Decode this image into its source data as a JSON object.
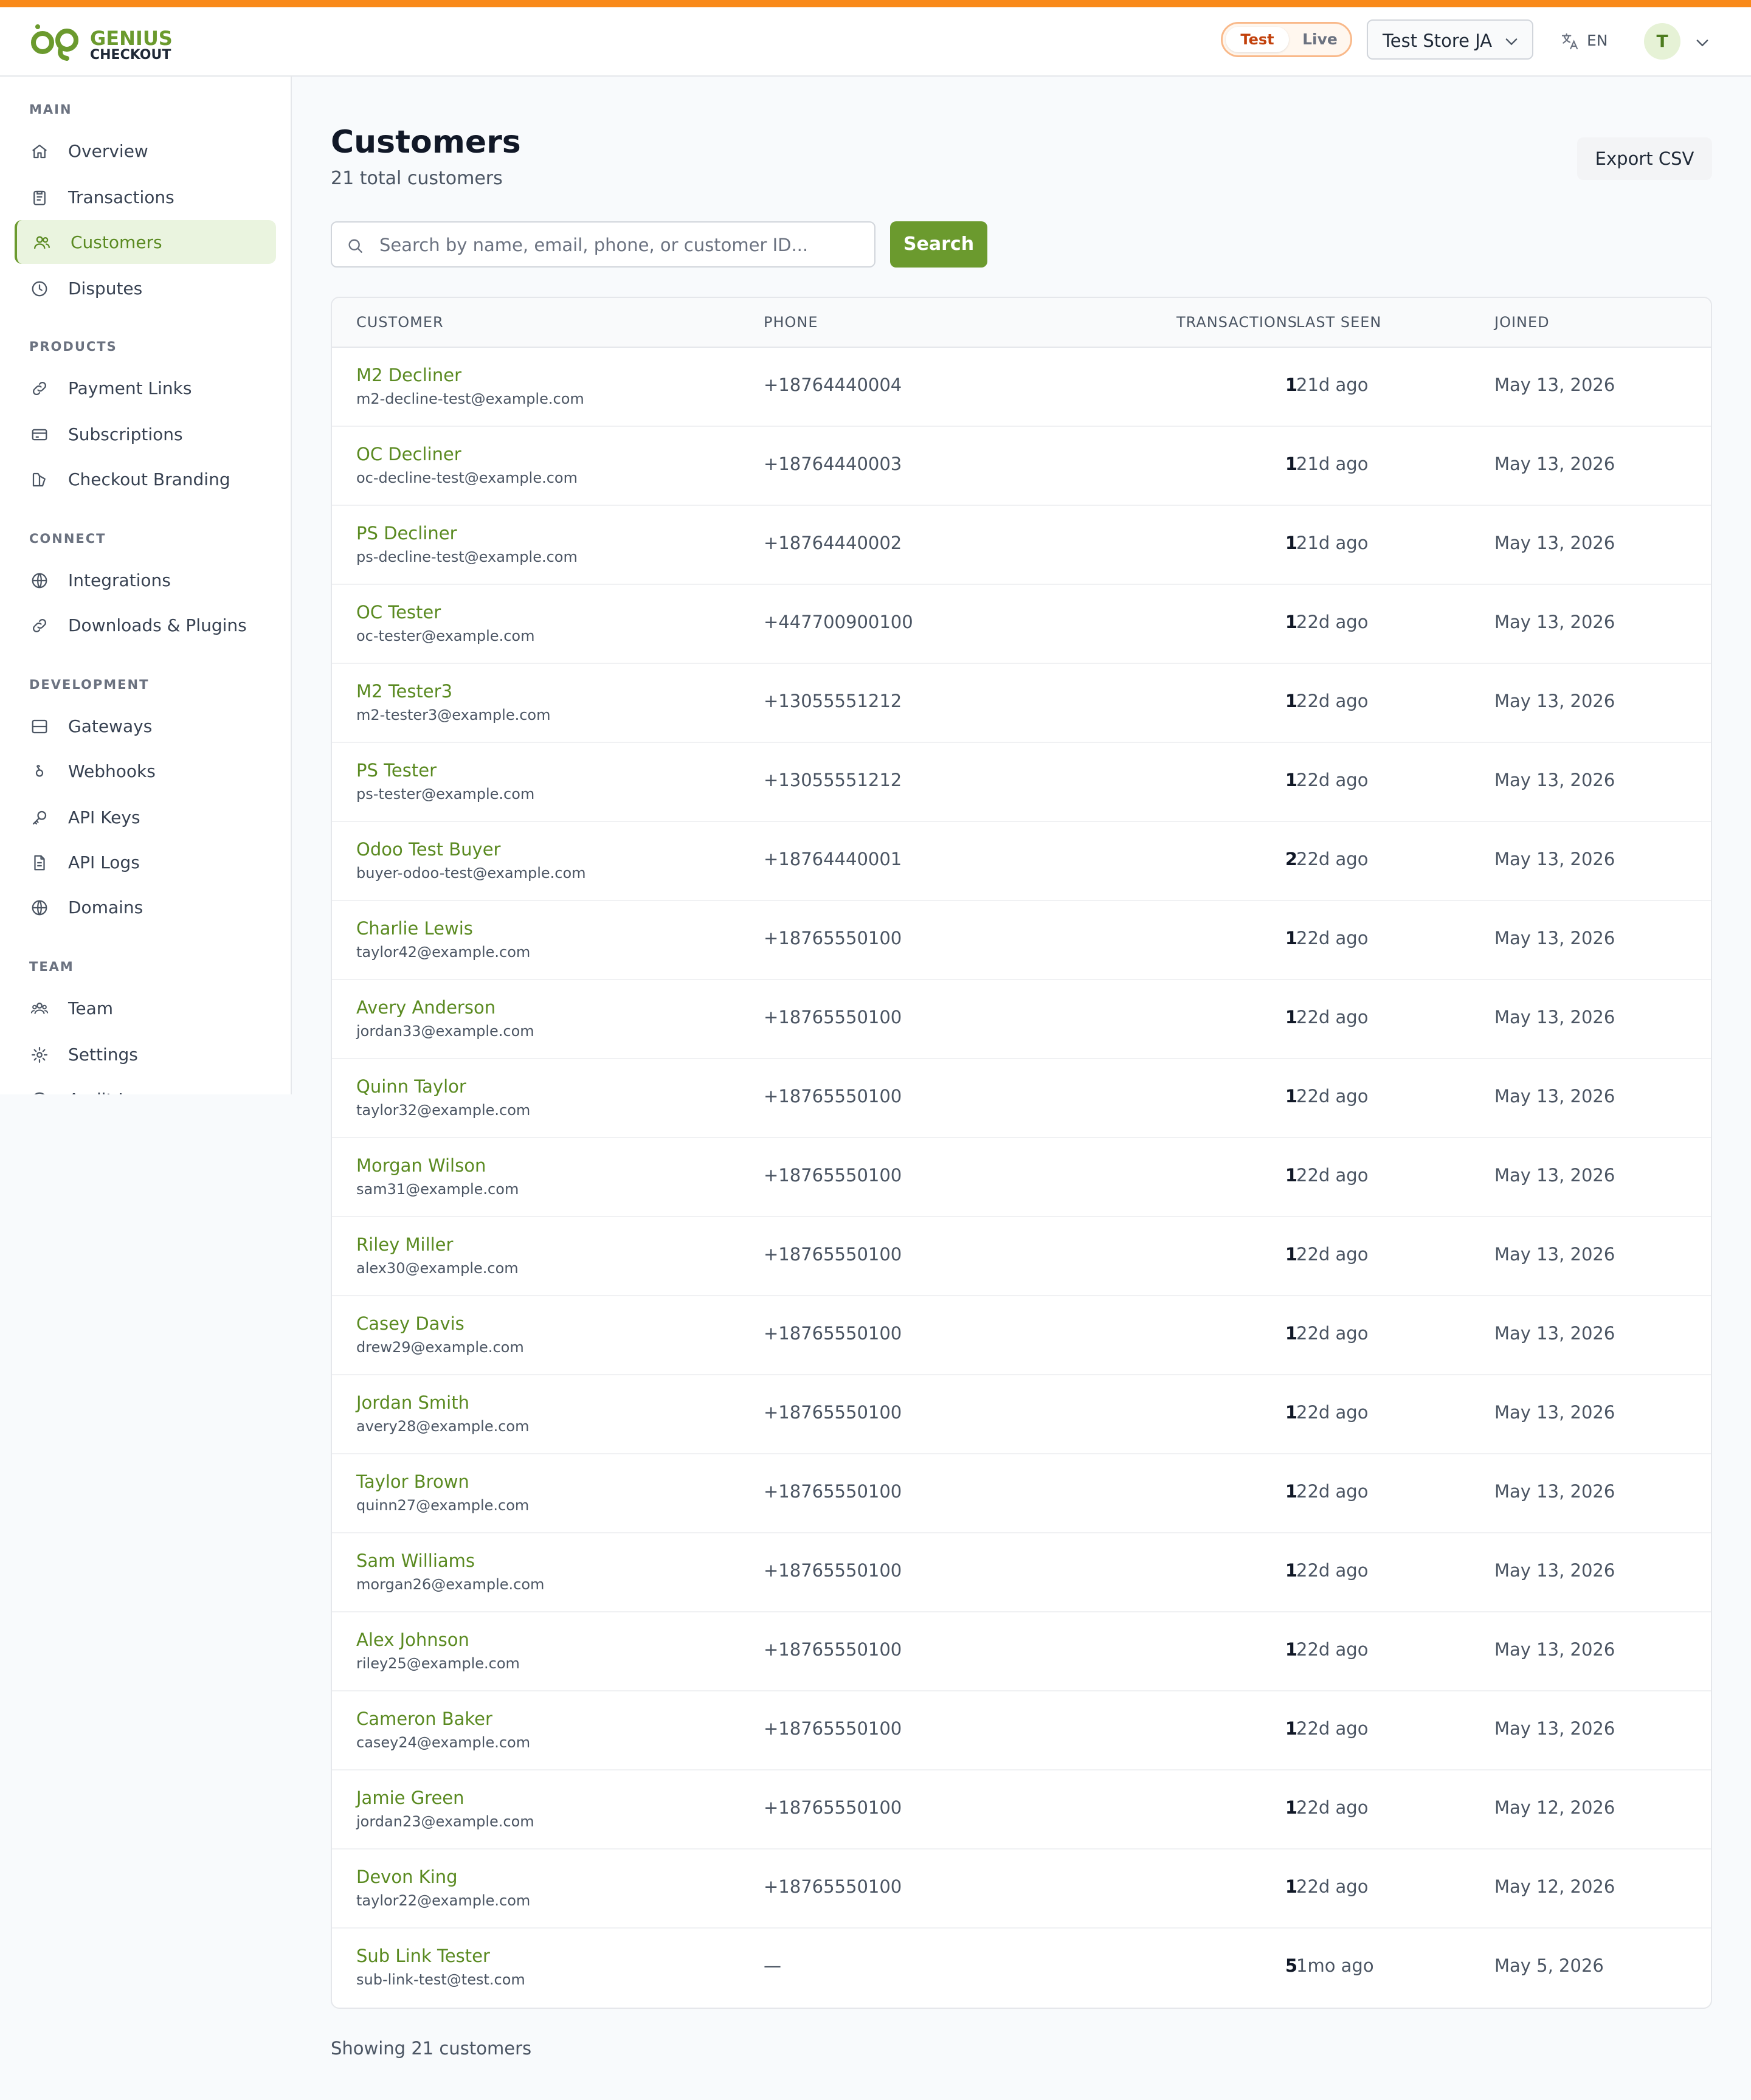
{
  "colors": {
    "accent": "#6b9a2e",
    "top_stripe": "#f98a1a",
    "test_mode": "#c2410c"
  },
  "header": {
    "logo_line1": "GENIUS",
    "logo_line2": "CHECKOUT",
    "mode_test": "Test",
    "mode_live": "Live",
    "store": "Test Store JA",
    "language": "EN",
    "avatar_initial": "T"
  },
  "sidebar": {
    "sections": [
      {
        "title": "MAIN",
        "items": [
          {
            "label": "Overview",
            "icon": "home-icon"
          },
          {
            "label": "Transactions",
            "icon": "clipboard-icon"
          },
          {
            "label": "Customers",
            "icon": "users-icon",
            "active": true
          },
          {
            "label": "Disputes",
            "icon": "clock-icon"
          }
        ]
      },
      {
        "title": "PRODUCTS",
        "items": [
          {
            "label": "Payment Links",
            "icon": "link-icon"
          },
          {
            "label": "Subscriptions",
            "icon": "card-icon"
          },
          {
            "label": "Checkout Branding",
            "icon": "paint-icon"
          }
        ]
      },
      {
        "title": "CONNECT",
        "items": [
          {
            "label": "Integrations",
            "icon": "globe-icon"
          },
          {
            "label": "Downloads & Plugins",
            "icon": "link-icon"
          }
        ]
      },
      {
        "title": "DEVELOPMENT",
        "items": [
          {
            "label": "Gateways",
            "icon": "server-icon"
          },
          {
            "label": "Webhooks",
            "icon": "webhook-icon"
          },
          {
            "label": "API Keys",
            "icon": "key-icon"
          },
          {
            "label": "API Logs",
            "icon": "file-icon"
          },
          {
            "label": "Domains",
            "icon": "globe-icon"
          }
        ]
      },
      {
        "title": "TEAM",
        "items": [
          {
            "label": "Team",
            "icon": "team-icon"
          },
          {
            "label": "Settings",
            "icon": "gear-icon"
          },
          {
            "label": "Audit Log",
            "icon": "clock-icon"
          }
        ]
      }
    ]
  },
  "page": {
    "title": "Customers",
    "subtitle": "21 total customers",
    "export_label": "Export CSV",
    "search_placeholder": "Search by name, email, phone, or customer ID...",
    "search_label": "Search",
    "footer": "Showing 21 customers"
  },
  "table": {
    "headers": [
      "CUSTOMER",
      "PHONE",
      "TRANSACTIONS",
      "LAST SEEN",
      "JOINED"
    ],
    "rows": [
      {
        "name": "M2 Decliner",
        "email": "m2-decline-test@example.com",
        "phone": "+18764440004",
        "transactions": "1",
        "last_seen": "21d ago",
        "joined": "May 13, 2026"
      },
      {
        "name": "OC Decliner",
        "email": "oc-decline-test@example.com",
        "phone": "+18764440003",
        "transactions": "1",
        "last_seen": "21d ago",
        "joined": "May 13, 2026"
      },
      {
        "name": "PS Decliner",
        "email": "ps-decline-test@example.com",
        "phone": "+18764440002",
        "transactions": "1",
        "last_seen": "21d ago",
        "joined": "May 13, 2026"
      },
      {
        "name": "OC Tester",
        "email": "oc-tester@example.com",
        "phone": "+447700900100",
        "transactions": "1",
        "last_seen": "22d ago",
        "joined": "May 13, 2026"
      },
      {
        "name": "M2 Tester3",
        "email": "m2-tester3@example.com",
        "phone": "+13055551212",
        "transactions": "1",
        "last_seen": "22d ago",
        "joined": "May 13, 2026"
      },
      {
        "name": "PS Tester",
        "email": "ps-tester@example.com",
        "phone": "+13055551212",
        "transactions": "1",
        "last_seen": "22d ago",
        "joined": "May 13, 2026"
      },
      {
        "name": "Odoo Test Buyer",
        "email": "buyer-odoo-test@example.com",
        "phone": "+18764440001",
        "transactions": "2",
        "last_seen": "22d ago",
        "joined": "May 13, 2026"
      },
      {
        "name": "Charlie Lewis",
        "email": "taylor42@example.com",
        "phone": "+18765550100",
        "transactions": "1",
        "last_seen": "22d ago",
        "joined": "May 13, 2026"
      },
      {
        "name": "Avery Anderson",
        "email": "jordan33@example.com",
        "phone": "+18765550100",
        "transactions": "1",
        "last_seen": "22d ago",
        "joined": "May 13, 2026"
      },
      {
        "name": "Quinn Taylor",
        "email": "taylor32@example.com",
        "phone": "+18765550100",
        "transactions": "1",
        "last_seen": "22d ago",
        "joined": "May 13, 2026"
      },
      {
        "name": "Morgan Wilson",
        "email": "sam31@example.com",
        "phone": "+18765550100",
        "transactions": "1",
        "last_seen": "22d ago",
        "joined": "May 13, 2026"
      },
      {
        "name": "Riley Miller",
        "email": "alex30@example.com",
        "phone": "+18765550100",
        "transactions": "1",
        "last_seen": "22d ago",
        "joined": "May 13, 2026"
      },
      {
        "name": "Casey Davis",
        "email": "drew29@example.com",
        "phone": "+18765550100",
        "transactions": "1",
        "last_seen": "22d ago",
        "joined": "May 13, 2026"
      },
      {
        "name": "Jordan Smith",
        "email": "avery28@example.com",
        "phone": "+18765550100",
        "transactions": "1",
        "last_seen": "22d ago",
        "joined": "May 13, 2026"
      },
      {
        "name": "Taylor Brown",
        "email": "quinn27@example.com",
        "phone": "+18765550100",
        "transactions": "1",
        "last_seen": "22d ago",
        "joined": "May 13, 2026"
      },
      {
        "name": "Sam Williams",
        "email": "morgan26@example.com",
        "phone": "+18765550100",
        "transactions": "1",
        "last_seen": "22d ago",
        "joined": "May 13, 2026"
      },
      {
        "name": "Alex Johnson",
        "email": "riley25@example.com",
        "phone": "+18765550100",
        "transactions": "1",
        "last_seen": "22d ago",
        "joined": "May 13, 2026"
      },
      {
        "name": "Cameron Baker",
        "email": "casey24@example.com",
        "phone": "+18765550100",
        "transactions": "1",
        "last_seen": "22d ago",
        "joined": "May 13, 2026"
      },
      {
        "name": "Jamie Green",
        "email": "jordan23@example.com",
        "phone": "+18765550100",
        "transactions": "1",
        "last_seen": "22d ago",
        "joined": "May 12, 2026"
      },
      {
        "name": "Devon King",
        "email": "taylor22@example.com",
        "phone": "+18765550100",
        "transactions": "1",
        "last_seen": "22d ago",
        "joined": "May 12, 2026"
      },
      {
        "name": "Sub Link Tester",
        "email": "sub-link-test@test.com",
        "phone": "—",
        "transactions": "5",
        "last_seen": "1mo ago",
        "joined": "May 5, 2026"
      }
    ]
  }
}
